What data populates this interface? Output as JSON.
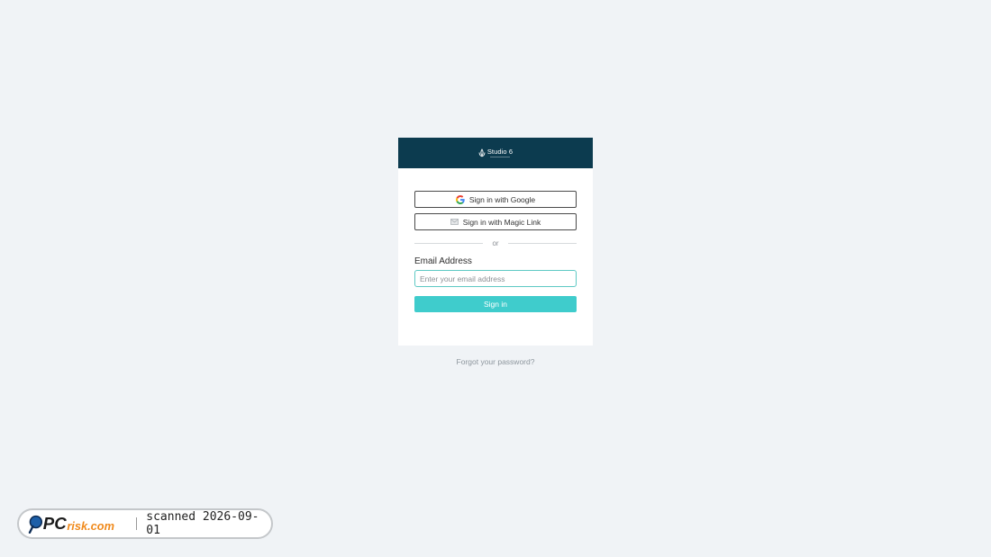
{
  "brand": {
    "logo_text": "Studio 6",
    "header_color": "#0c3b4f"
  },
  "oauth": {
    "google_label": "Sign in with Google",
    "magic_link_label": "Sign in with Magic Link"
  },
  "divider_text": "or",
  "email": {
    "label": "Email Address",
    "placeholder": "Enter your email address",
    "value": ""
  },
  "signin_label": "Sign in",
  "signin_color": "#3fcccc",
  "forgot_label": "Forgot your password?",
  "watermark": {
    "logo_text": "PCrisk.com",
    "scan_text": "scanned 2026-09-01"
  }
}
